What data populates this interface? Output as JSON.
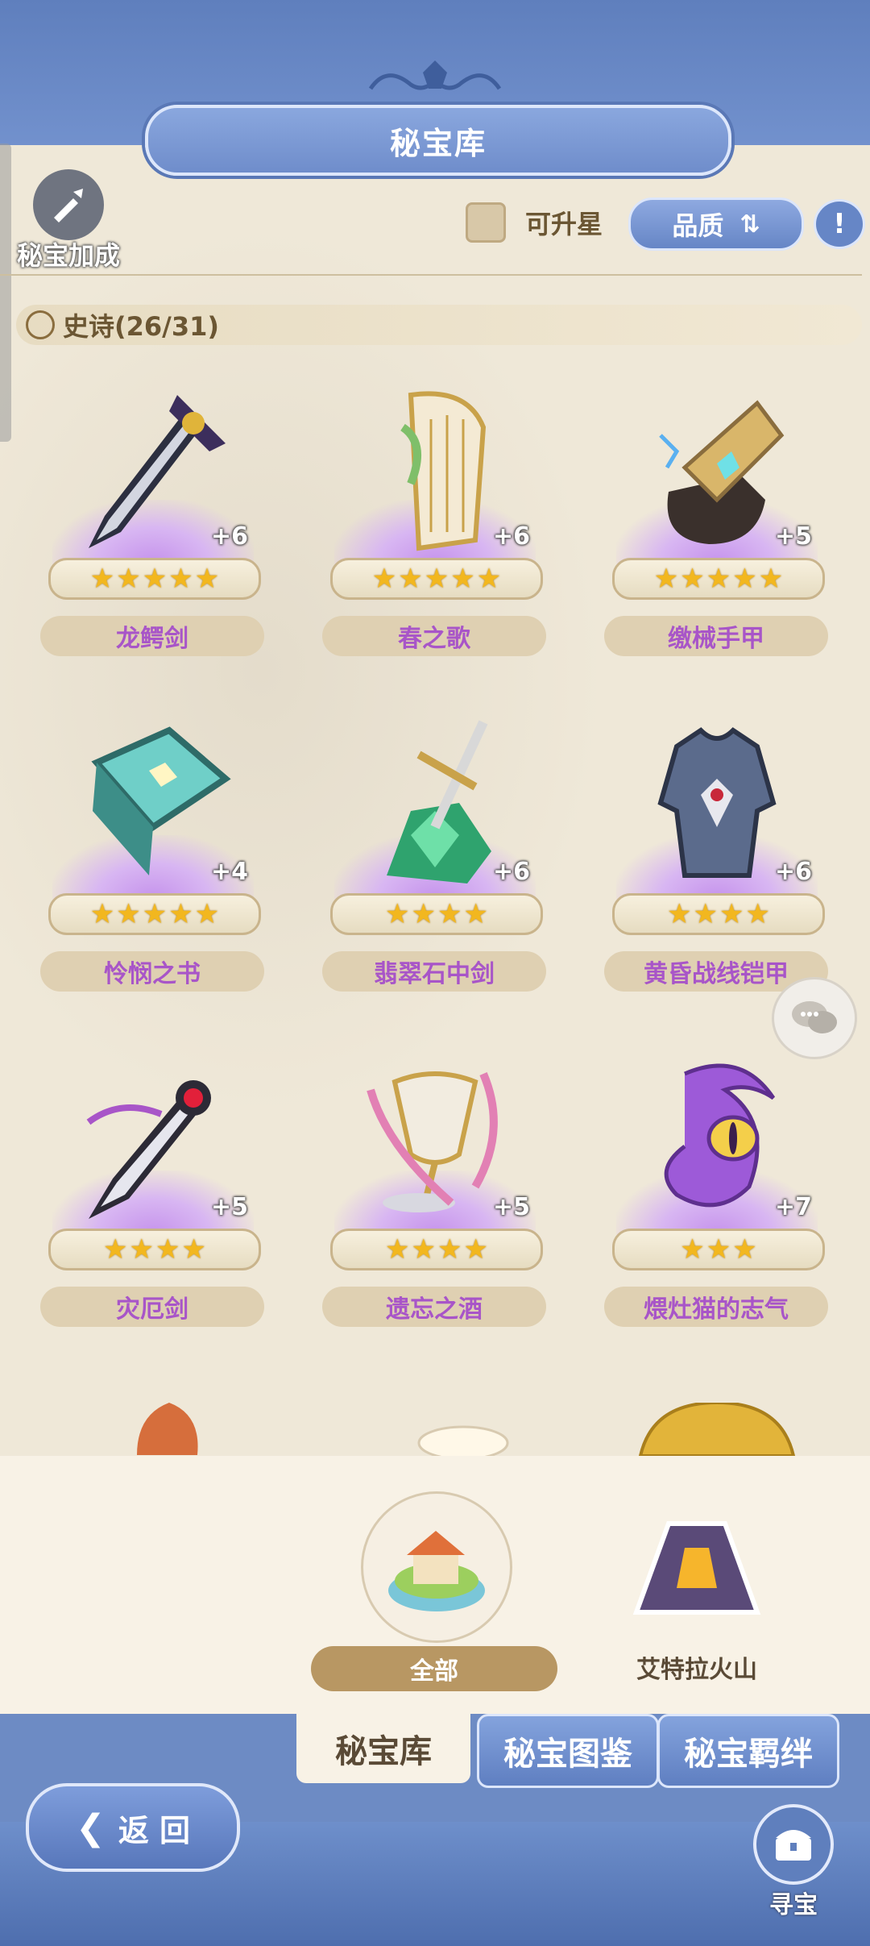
{
  "header": {
    "title": "秘宝库"
  },
  "toolbar": {
    "bonus_label": "秘宝加成",
    "upgradable_label": "可升星",
    "sort_label": "品质",
    "sort_icon": "sort-arrows-icon",
    "info_icon": "info-icon"
  },
  "section": {
    "label": "史诗(26/31)"
  },
  "items": [
    {
      "name": "龙鳄剑",
      "level": "+6",
      "stars": 5
    },
    {
      "name": "春之歌",
      "level": "+6",
      "stars": 5
    },
    {
      "name": "缴械手甲",
      "level": "+5",
      "stars": 5
    },
    {
      "name": "怜悯之书",
      "level": "+4",
      "stars": 5
    },
    {
      "name": "翡翠石中剑",
      "level": "+6",
      "stars": 4
    },
    {
      "name": "黄昏战线铠甲",
      "level": "+6",
      "stars": 4
    },
    {
      "name": "灾厄剑",
      "level": "+5",
      "stars": 4
    },
    {
      "name": "遗忘之酒",
      "level": "+5",
      "stars": 4
    },
    {
      "name": "煨灶猫的志气",
      "level": "+7",
      "stars": 3
    }
  ],
  "regions": [
    {
      "label": "全部",
      "selected": true
    },
    {
      "label": "艾特拉火山",
      "selected": false
    }
  ],
  "tabs": [
    "秘宝库",
    "秘宝图鉴",
    "秘宝羁绊"
  ],
  "footer": {
    "back_label": "返 回",
    "treasure_label": "寻宝"
  },
  "colors": {
    "accent_blue": "#6f8dcb",
    "epic_purple": "#a855c8",
    "star_gold": "#f2b71f",
    "panel_bg": "#efe8d8"
  }
}
